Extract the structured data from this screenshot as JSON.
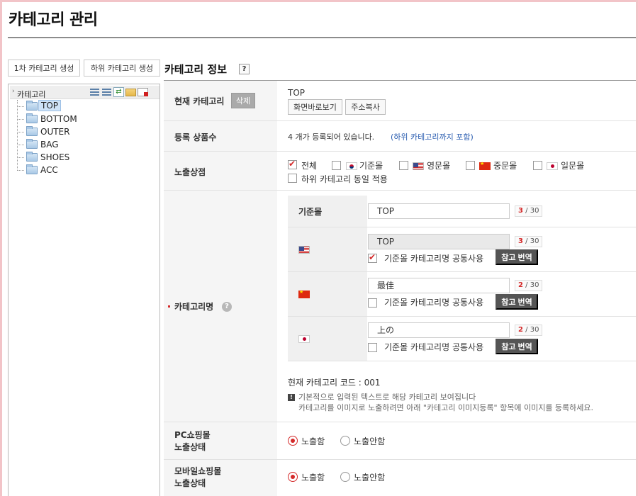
{
  "page": {
    "title": "카테고리 관리"
  },
  "actions": {
    "create_first": "1차 카테고리 생성",
    "create_sub": "하위 카테고리 생성"
  },
  "tree": {
    "root_label": "카테고리",
    "items": [
      {
        "label": "TOP",
        "selected": true
      },
      {
        "label": "BOTTOM"
      },
      {
        "label": "OUTER"
      },
      {
        "label": "BAG"
      },
      {
        "label": "SHOES"
      },
      {
        "label": "ACC"
      }
    ]
  },
  "info": {
    "title": "카테고리 정보",
    "help": "?",
    "current": {
      "label": "현재 카테고리",
      "delete": "삭제",
      "value": "TOP",
      "shortcut": "화면바로보기",
      "copy_url": "주소복사"
    },
    "count": {
      "label": "등록 상품수",
      "value": "4 개가 등록되어 있습니다.",
      "link": "(하위 카테고리까지 포함)"
    },
    "shops": {
      "label": "노출상점",
      "options": [
        {
          "label": "전체",
          "checked": true,
          "flag": ""
        },
        {
          "label": "기준몰",
          "checked": false,
          "flag": "korea-flag-icon"
        },
        {
          "label": "영문몰",
          "checked": false,
          "flag": "usa-flag-icon"
        },
        {
          "label": "중문몰",
          "checked": false,
          "flag": "china-flag-icon"
        },
        {
          "label": "일문몰",
          "checked": false,
          "flag": "japan-flag-icon"
        }
      ],
      "apply_sub": "하위 카테고리 동일 적용"
    },
    "name": {
      "label": "카테고리명",
      "help": "?",
      "base": {
        "label": "기준몰",
        "value": "TOP",
        "count": "3",
        "max": "/ 30"
      },
      "en": {
        "value": "TOP",
        "count": "3",
        "max": "/ 30",
        "share": "기준몰 카테고리명 공통사용",
        "translate": "참고 번역"
      },
      "cn": {
        "value": "最佳",
        "count": "2",
        "max": "/ 30",
        "share": "기준몰 카테고리명 공통사용",
        "translate": "참고 번역"
      },
      "jp": {
        "value": "上の",
        "count": "2",
        "max": "/ 30",
        "share": "기준몰 카테고리명 공통사용",
        "translate": "참고 번역"
      },
      "code": "현재 카테고리 코드 : 001",
      "note1": "기본적으로 입력된 텍스트로 해당 카테고리 보여집니다",
      "note2": "카테고리를 이미지로 노출하려면 아래 \"카테고리 이미지등록\" 항목에 이미지를 등록하세요."
    },
    "pc_status": {
      "label1": "PC쇼핑몰",
      "label2": "노출상태",
      "show": "노출함",
      "hide": "노출안함",
      "selected": "show"
    },
    "mobile_status": {
      "label1": "모바일쇼핑몰",
      "label2": "노출상태",
      "show": "노출함",
      "hide": "노출안함",
      "selected": "show"
    }
  },
  "colors": {
    "accent": "#d42a2a",
    "frame": "#f2c4c8",
    "label_bg": "#f5f5f5"
  }
}
